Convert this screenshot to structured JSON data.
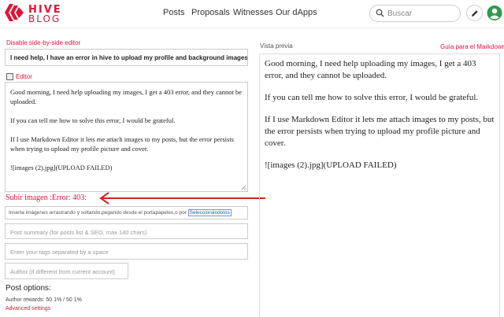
{
  "header": {
    "logo_top": "HIVE",
    "logo_bottom": "BLOG",
    "nav": [
      "Posts",
      "Proposals",
      "Witnesses",
      "Our dApps"
    ],
    "search_placeholder": "Buscar"
  },
  "editor": {
    "disable_link": "Disable side-by-side editor",
    "title_value": "I need help, I have an error in hive to upload my profile and background images.",
    "editor_tab": "Editor",
    "body_paragraphs": [
      "Good morning, I need help uploading my images, I get a 403 error, and they cannot be uploaded.",
      "If you can tell me how to solve this error, I would be grateful.",
      "If I use Markdown Editor it lets me attach images to my posts, but the error persists when trying to upload my profile picture and cover.",
      "![images (2).jpg](UPLOAD FAILED)"
    ],
    "upload_error": "Subir imagen :Error: 403:",
    "drop_text": "Inserta imágenes arrastrando y soltando,pegando desde el portapapeles,o por ",
    "drop_link": "Seleccionándolos",
    "summary_placeholder": "Post summary (for posts list & SEO, max 140 chars)",
    "tags_placeholder": "Enter your tags separated by a space",
    "author_placeholder": "Author (if different from current account)",
    "post_options": "Post options:",
    "author_rewards": "Author rewards: 50 1% / 50 1%",
    "advanced_settings": "Advanced settings"
  },
  "preview": {
    "label": "Vista previa",
    "guide_link": "Guía para el Markdown",
    "paragraphs": [
      "Good morning, I need help uploading my images, I get a 403 error, and they cannot be uploaded.",
      "If you can tell me how to solve this error, I would be grateful.",
      "If I use Markdown Editor it lets me attach images to my posts, but the error persists when trying to upload my profile picture and cover.",
      "![images (2).jpg](UPLOAD FAILED)"
    ]
  },
  "colors": {
    "brand": "#e31337",
    "link": "#1a5fb4",
    "avatar": "#2e9a4a"
  },
  "icons": [
    "hive-logo-icon",
    "search-icon",
    "pencil-icon",
    "avatar-icon",
    "checkbox-icon",
    "resize-handle-icon",
    "red-arrow-annotation"
  ]
}
